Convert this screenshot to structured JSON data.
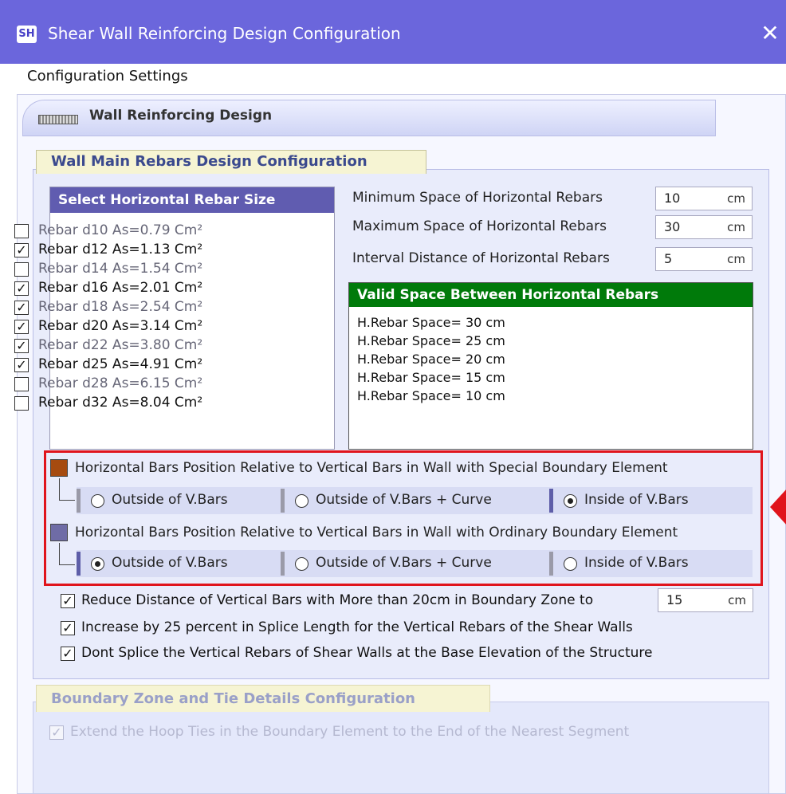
{
  "window": {
    "app_icon": "SH",
    "title": "Shear Wall Reinforcing Design Configuration",
    "close": "✕"
  },
  "menu": {
    "item": "Configuration Settings"
  },
  "group": {
    "title": "Wall Reinforcing Design"
  },
  "section": {
    "title": "Wall Main Rebars Design Configuration"
  },
  "rebar_list": {
    "header": "Select Horizontal Rebar Size",
    "items": [
      {
        "label": "Rebar d10   As=0.79  Cm²",
        "checked": false,
        "mark": ""
      },
      {
        "label": "Rebar d12   As=1.13  Cm²",
        "checked": true,
        "mark": "✓"
      },
      {
        "label": "Rebar d14   As=1.54  Cm²",
        "checked": false,
        "mark": ""
      },
      {
        "label": "Rebar d16   As=2.01  Cm²",
        "checked": true,
        "mark": "✓"
      },
      {
        "label": "Rebar d18   As=2.54  Cm²",
        "checked": true,
        "mark": "✓"
      },
      {
        "label": "Rebar d20   As=3.14  Cm²",
        "checked": true,
        "mark": "✓"
      },
      {
        "label": "Rebar d22   As=3.80  Cm²",
        "checked": true,
        "mark": "✓"
      },
      {
        "label": "Rebar d25   As=4.91  Cm²",
        "checked": true,
        "mark": "✓"
      },
      {
        "label": "Rebar d28   As=6.15  Cm²",
        "checked": false,
        "mark": ""
      },
      {
        "label": "Rebar d32   As=8.04  Cm²",
        "checked": false,
        "mark": ""
      }
    ]
  },
  "spacing": {
    "min": {
      "label": "Minimum  Space of  Horizontal Rebars",
      "value": "10",
      "unit": "cm"
    },
    "max": {
      "label": "Maximum Space of  Horizontal Rebars",
      "value": "30",
      "unit": "cm"
    },
    "interval": {
      "label": "Interval Distance of Horizontal Rebars",
      "value": "5",
      "unit": "cm"
    }
  },
  "valid_space": {
    "header": "Valid Space Between Horizontal Rebars",
    "lines": [
      "H.Rebar Space= 30 cm",
      "H.Rebar Space= 25 cm",
      "H.Rebar Space= 20 cm",
      "H.Rebar Space= 15 cm",
      "H.Rebar Space= 10 cm"
    ]
  },
  "special_boundary": {
    "label": "Horizontal Bars Position Relative to Vertical Bars in Wall with Special Boundary Element",
    "color": "#a64b10",
    "options": [
      "Outside of V.Bars",
      "Outside of V.Bars + Curve",
      "Inside of V.Bars"
    ],
    "selected": 2
  },
  "ordinary_boundary": {
    "label": "Horizontal Bars Position Relative to Vertical Bars in Wall with Ordinary Boundary Element",
    "color": "#6f6ca6",
    "options": [
      "Outside of V.Bars",
      "Outside of V.Bars + Curve",
      "Inside of V.Bars"
    ],
    "selected": 0
  },
  "options": {
    "reduce": {
      "label": "Reduce Distance of Vertical Bars with More than 20cm in Boundary Zone to",
      "value": "15",
      "unit": "cm",
      "checked": true
    },
    "increase": {
      "label": "Increase by 25 percent in Splice Length for the Vertical Rebars of the Shear Walls",
      "checked": true
    },
    "dont_splice": {
      "label": "Dont Splice the Vertical Rebars of Shear Walls at the Base Elevation of the Structure",
      "checked": true
    },
    "mark": "✓"
  },
  "boundary_section": {
    "title": "Boundary Zone and Tie Details Configuration",
    "extend_label": "Extend the Hoop Ties in the Boundary Element to the End of the Nearest Segment",
    "extend_mark": "✓"
  }
}
